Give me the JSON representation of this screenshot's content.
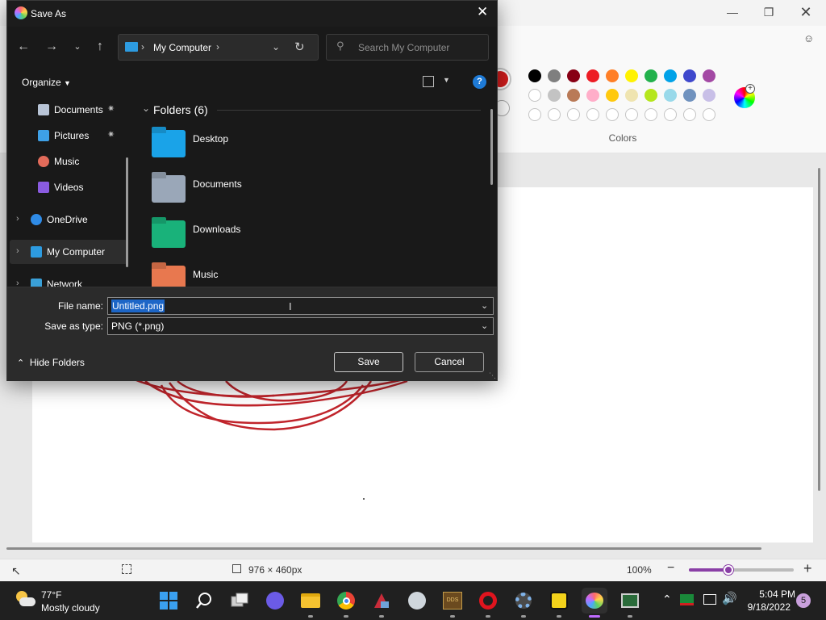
{
  "paint": {
    "status": {
      "canvas_size": "976 × 460px",
      "zoom": "100%",
      "zoom_level": 0.38
    },
    "colors_label": "Colors",
    "palette_row1": [
      "#000000",
      "#7f7f7f",
      "#880015",
      "#ed1c24",
      "#ff7f27",
      "#fff200",
      "#22b14c",
      "#00a2e8",
      "#3f48cc",
      "#a349a4"
    ],
    "palette_row2": [
      "#ffffff",
      "#c3c3c3",
      "#b97a57",
      "#ffaec9",
      "#ffc90e",
      "#efe4b0",
      "#b5e61d",
      "#99d9ea",
      "#7092be",
      "#c8bfe7"
    ],
    "selected_color": "#d31d1d",
    "stroke_color": "#c0242b"
  },
  "dialog": {
    "title": "Save As",
    "address": {
      "location": "My Computer"
    },
    "search": {
      "placeholder": "Search My Computer"
    },
    "organize_label": "Organize",
    "nav": {
      "items": [
        {
          "label": "Documents",
          "icon": "document-icon",
          "pinned": true
        },
        {
          "label": "Pictures",
          "icon": "pictures-icon",
          "pinned": true
        },
        {
          "label": "Music",
          "icon": "music-icon",
          "pinned": false
        },
        {
          "label": "Videos",
          "icon": "videos-icon",
          "pinned": false
        },
        {
          "label": "OneDrive",
          "icon": "cloud-icon",
          "pinned": false
        },
        {
          "label": "My Computer",
          "icon": "computer-icon",
          "pinned": false,
          "selected": true
        },
        {
          "label": "Network",
          "icon": "network-icon",
          "pinned": false
        }
      ]
    },
    "folders": {
      "header": "Folders (6)",
      "items": [
        {
          "name": "Desktop",
          "color": "#1aa3e8",
          "icon": "desktop-folder-icon"
        },
        {
          "name": "Documents",
          "color": "#9aa7b8",
          "icon": "documents-folder-icon"
        },
        {
          "name": "Downloads",
          "color": "#19b27a",
          "icon": "downloads-folder-icon"
        },
        {
          "name": "Music",
          "color": "#e8784f",
          "icon": "music-folder-icon"
        }
      ]
    },
    "form": {
      "filename_label": "File name:",
      "filename_value": "Untitled.png",
      "type_label": "Save as type:",
      "type_value": "PNG (*.png)"
    },
    "hide_folders_label": "Hide Folders",
    "save_label": "Save",
    "cancel_label": "Cancel"
  },
  "taskbar": {
    "weather": {
      "temp": "77°F",
      "condition": "Mostly cloudy"
    },
    "clock": {
      "time": "5:04 PM",
      "date": "9/18/2022"
    },
    "notification_count": "5",
    "apps": [
      "start-icon",
      "search-icon",
      "task-view-icon",
      "chat-icon",
      "file-explorer-icon",
      "chrome-icon",
      "app-icon",
      "tool-icon",
      "game-icon",
      "opera-icon",
      "settings-icon",
      "remote-icon",
      "paint-icon",
      "terminal-icon"
    ]
  }
}
